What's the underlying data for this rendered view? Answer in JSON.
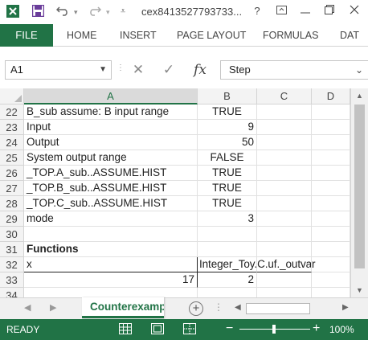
{
  "titlebar": {
    "title": "cex8413527793733...",
    "help_label": "?",
    "icon_undo": "undo-icon",
    "icon_redo": "redo-icon"
  },
  "ribbon": {
    "tabs": [
      {
        "label": "FILE"
      },
      {
        "label": "HOME"
      },
      {
        "label": "INSERT"
      },
      {
        "label": "PAGE LAYOUT"
      },
      {
        "label": "FORMULAS"
      },
      {
        "label": "DAT"
      }
    ],
    "accent_color": "#217346"
  },
  "formula_bar": {
    "name_box": "A1",
    "cancel_symbol": "✕",
    "enter_symbol": "✓",
    "fx_label": "fx",
    "content": "Step"
  },
  "grid": {
    "columns": [
      "A",
      "B",
      "C",
      "D"
    ],
    "rows": [
      {
        "num": "22",
        "A": "B_sub assume: B input range",
        "B": "TRUE"
      },
      {
        "num": "23",
        "A": "Input",
        "B": "9"
      },
      {
        "num": "24",
        "A": "Output",
        "B": "50"
      },
      {
        "num": "25",
        "A": "System output range",
        "B": "FALSE"
      },
      {
        "num": "26",
        "A": "_TOP.A_sub..ASSUME.HIST",
        "B": "TRUE"
      },
      {
        "num": "27",
        "A": "_TOP.B_sub..ASSUME.HIST",
        "B": "TRUE"
      },
      {
        "num": "28",
        "A": "_TOP.C_sub..ASSUME.HIST",
        "B": "TRUE"
      },
      {
        "num": "29",
        "A": "mode",
        "B": "3"
      },
      {
        "num": "30",
        "A": "",
        "B": ""
      },
      {
        "num": "31",
        "A": "Functions",
        "B": ""
      },
      {
        "num": "32",
        "A": "x",
        "B": "Integer_Toy.C.uf._outvar"
      },
      {
        "num": "33",
        "A": "17",
        "B": "2"
      },
      {
        "num": "34",
        "A": "",
        "B": ""
      }
    ]
  },
  "sheet_tabs": {
    "active": "Counterexample"
  },
  "status_bar": {
    "ready": "READY",
    "zoom": "100%",
    "minus": "−",
    "plus": "+"
  }
}
